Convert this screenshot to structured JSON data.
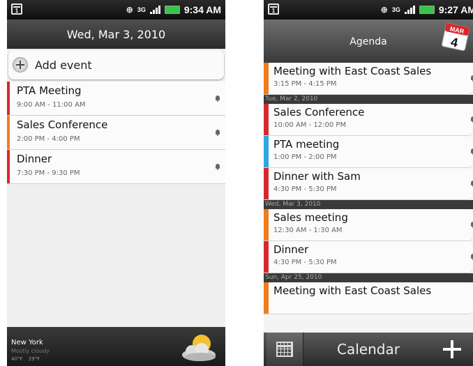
{
  "left": {
    "status": {
      "network": "3G",
      "time": "9:34 AM",
      "calendar_day": "1"
    },
    "date_header": "Wed, Mar 3, 2010",
    "add_event_label": "Add event",
    "events": [
      {
        "title": "PTA Meeting",
        "time": "9:00 AM - 11:00 AM",
        "color": "#d8282f"
      },
      {
        "title": "Sales Conference",
        "time": "2:00 PM - 4:00 PM",
        "color": "#f07c1e"
      },
      {
        "title": "Dinner",
        "time": "7:30 PM - 9:30 PM",
        "color": "#d8282f"
      }
    ],
    "weather": {
      "city": "New York",
      "condition": "Mostly cloudy",
      "high": "40°F",
      "low": "29°F"
    }
  },
  "right": {
    "status": {
      "network": "3G",
      "time": "9:27 AM",
      "calendar_day": "1"
    },
    "title": "Agenda",
    "calendar_badge": {
      "month": "MAR",
      "day": "4"
    },
    "rows": [
      {
        "type": "event",
        "title": "Meeting with East Coast Sales",
        "time": "3:15 PM - 4:15 PM",
        "color": "#f07c1e"
      },
      {
        "type": "date",
        "label": "Tue, Mar 2, 2010"
      },
      {
        "type": "event",
        "title": "Sales Conference",
        "time": "10:00 AM - 12:00 PM",
        "color": "#d8282f"
      },
      {
        "type": "event",
        "title": "PTA meeting",
        "time": "1:00 PM - 2:00 PM",
        "color": "#2ea8e0"
      },
      {
        "type": "event",
        "title": "Dinner with Sam",
        "time": "4:30 PM - 5:30 PM",
        "color": "#d8282f"
      },
      {
        "type": "date",
        "label": "Wed, Mar 3, 2010"
      },
      {
        "type": "event",
        "title": "Sales meeting",
        "time": "12:30 AM - 1:30 AM",
        "color": "#f07c1e"
      },
      {
        "type": "event",
        "title": "Dinner",
        "time": "4:30 PM - 5:30 PM",
        "color": "#d8282f"
      },
      {
        "type": "date",
        "label": "Sun, Apr 25, 2010"
      },
      {
        "type": "event",
        "title": "Meeting with East Coast Sales",
        "time": "",
        "color": "#f07c1e"
      }
    ],
    "bottom_label": "Calendar"
  }
}
